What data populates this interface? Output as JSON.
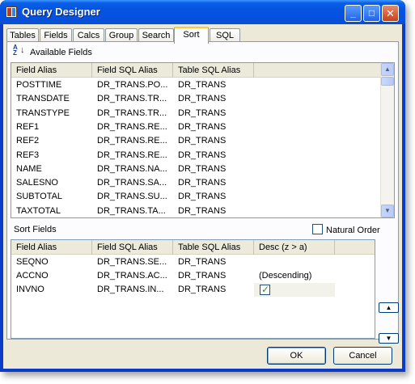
{
  "window": {
    "title": "Query Designer",
    "minimize_label": "_",
    "maximize_label": "□",
    "close_label": "✕"
  },
  "tabs": [
    "Tables",
    "Fields",
    "Calcs",
    "Group",
    "Search",
    "Sort",
    "SQL"
  ],
  "active_tab": "Sort",
  "available_fields": {
    "heading": "Available Fields",
    "sort_glyph": {
      "top": "A",
      "bottom": "Z",
      "arrow": "↓"
    },
    "columns": [
      "Field Alias",
      "Field SQL Alias",
      "Table SQL Alias"
    ],
    "rows": [
      [
        "POSTTIME",
        "DR_TRANS.PO...",
        "DR_TRANS"
      ],
      [
        "TRANSDATE",
        "DR_TRANS.TR...",
        "DR_TRANS"
      ],
      [
        "TRANSTYPE",
        "DR_TRANS.TR...",
        "DR_TRANS"
      ],
      [
        "REF1",
        "DR_TRANS.RE...",
        "DR_TRANS"
      ],
      [
        "REF2",
        "DR_TRANS.RE...",
        "DR_TRANS"
      ],
      [
        "REF3",
        "DR_TRANS.RE...",
        "DR_TRANS"
      ],
      [
        "NAME",
        "DR_TRANS.NA...",
        "DR_TRANS"
      ],
      [
        "SALESNO",
        "DR_TRANS.SA...",
        "DR_TRANS"
      ],
      [
        "SUBTOTAL",
        "DR_TRANS.SU...",
        "DR_TRANS"
      ],
      [
        "TAXTOTAL",
        "DR_TRANS.TA...",
        "DR_TRANS"
      ]
    ],
    "scroll_up": "▲",
    "scroll_down": "▼"
  },
  "sort_fields": {
    "heading": "Sort Fields",
    "natural_order_label": "Natural Order",
    "natural_order_checked": false,
    "columns": [
      "Field Alias",
      "Field SQL Alias",
      "Table SQL Alias",
      "Desc (z > a)"
    ],
    "rows": [
      {
        "alias": "SEQNO",
        "sql": "DR_TRANS.SE...",
        "table": "DR_TRANS",
        "desc": ""
      },
      {
        "alias": "ACCNO",
        "sql": "DR_TRANS.AC...",
        "table": "DR_TRANS",
        "desc": "(Descending)"
      },
      {
        "alias": "INVNO",
        "sql": "DR_TRANS.IN...",
        "table": "DR_TRANS",
        "desc_checked": true
      }
    ],
    "move_up_icon": "▲",
    "move_down_icon": "▼"
  },
  "buttons": {
    "ok": "OK",
    "cancel": "Cancel"
  },
  "colors": {
    "titlebar": "#0553e0",
    "client": "#ece9d8",
    "active_tab_highlight": "#ffc83c"
  }
}
